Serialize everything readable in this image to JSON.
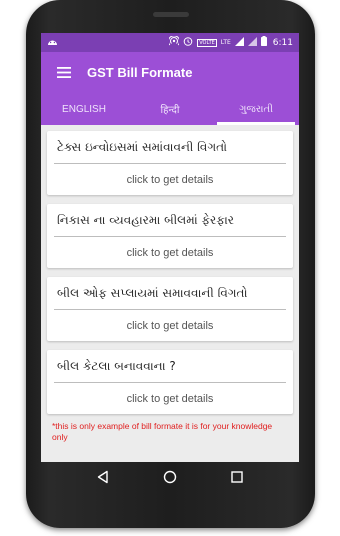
{
  "status_bar": {
    "time": "6:11",
    "volte_label": "VOLTE",
    "lte_label": "LTE",
    "icons": [
      "android-notification-icon",
      "hotspot-icon",
      "alarm-icon",
      "signal-icon",
      "battery-icon"
    ]
  },
  "app_bar": {
    "title": "GST Bill Formate",
    "menu_icon": "hamburger-menu-icon"
  },
  "tabs": [
    {
      "label": "ENGLISH",
      "active": false
    },
    {
      "label": "हिन्दी",
      "active": false
    },
    {
      "label": "ગુજરાતી",
      "active": true
    }
  ],
  "cards": [
    {
      "title": "ટેક્સ ઇન્વોઇસમાં સમાંવાવની વિગતો",
      "action": "click to get details"
    },
    {
      "title": "નિકાસ ના વ્યવહારમા બીલમાં ફેરફાર",
      "action": "click to get details"
    },
    {
      "title": "બીલ ઓફ સપ્લાયમાં સમાવવાની વિગતો",
      "action": "click to get details"
    },
    {
      "title": "બીલ કેટલા બનાવવાના ?",
      "action": "click to get details"
    }
  ],
  "note": "*this is only example of bill formate it is for your knowledge only",
  "colors": {
    "status_bar": "#7b3fb3",
    "app_bar": "#9c4fd6",
    "note": "#e02020",
    "background": "#ececec"
  },
  "nav": [
    "back-icon",
    "home-icon",
    "recents-icon"
  ]
}
